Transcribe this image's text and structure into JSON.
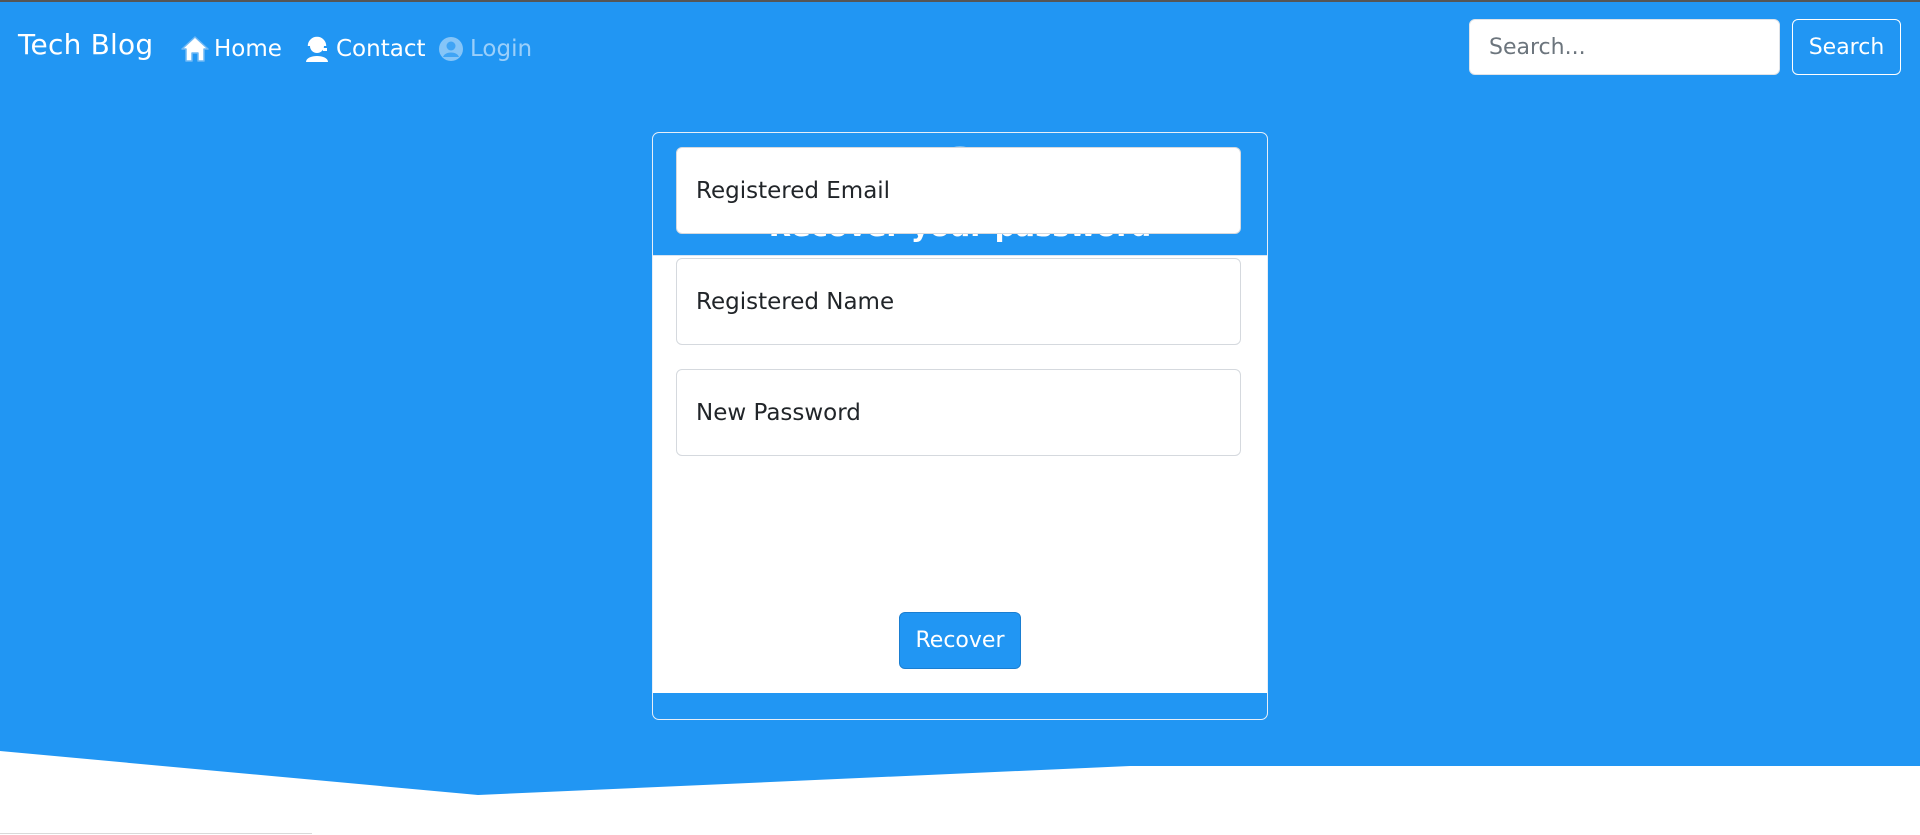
{
  "brand": "Tech Blog",
  "nav": {
    "home": "Home",
    "contact": "Contact",
    "login": "Login"
  },
  "search": {
    "placeholder": "Search...",
    "button": "Search"
  },
  "form": {
    "title": "Recover your password",
    "email_placeholder": "Registered Email",
    "name_placeholder": "Registered Name",
    "password_placeholder": "New Password",
    "submit": "Recover"
  },
  "colors": {
    "primary": "#2196f3",
    "white": "#ffffff"
  },
  "icons": {
    "home": "home-icon",
    "contact": "contact-support-icon",
    "login": "user-circle-icon",
    "lock": "unlock-icon"
  }
}
